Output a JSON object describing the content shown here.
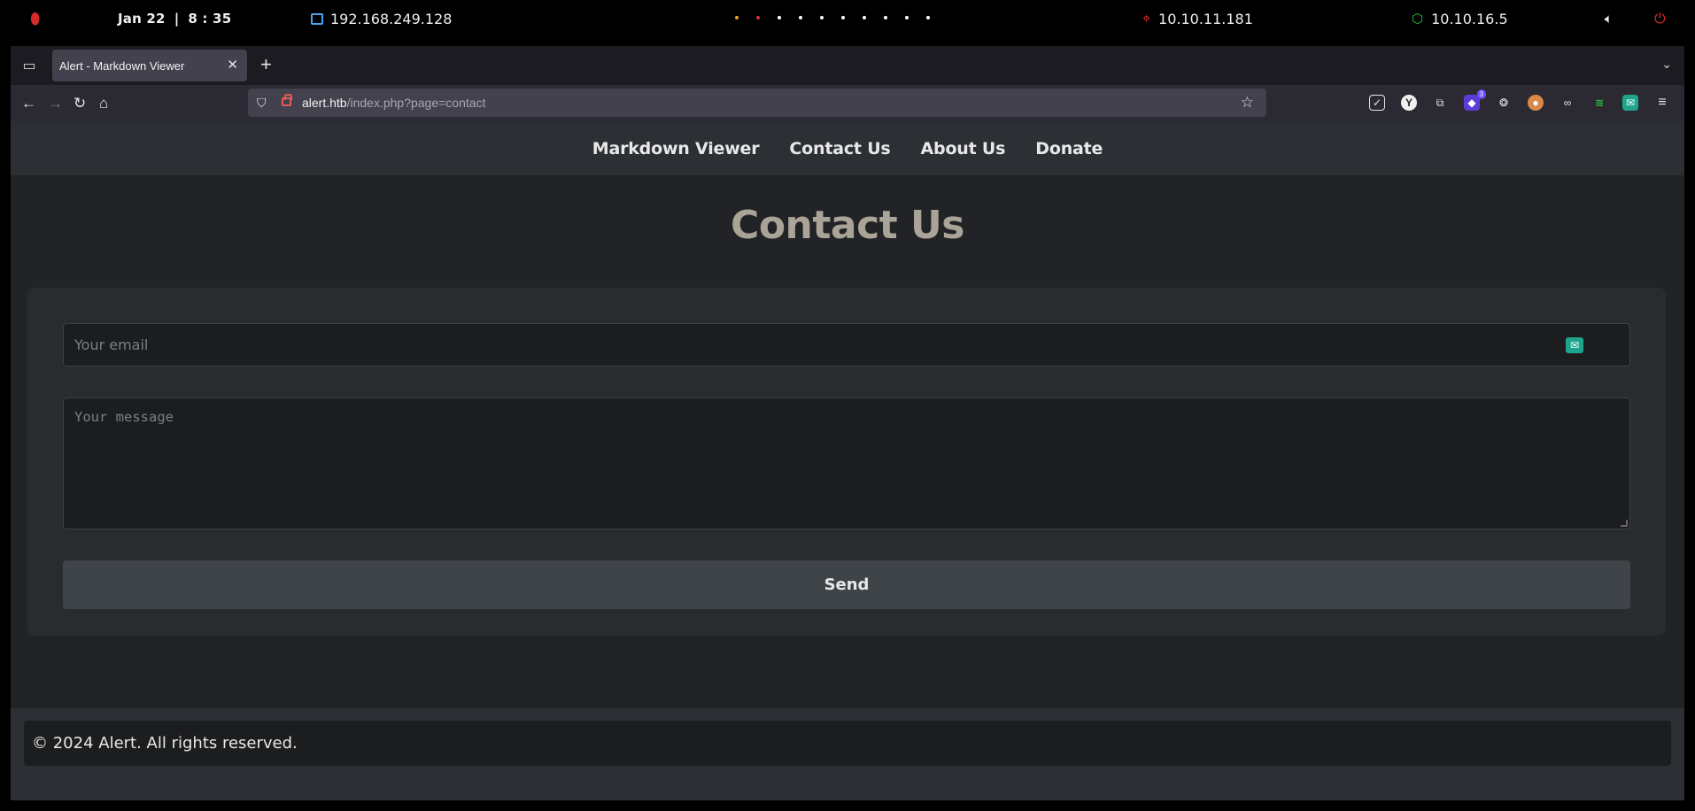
{
  "system_bar": {
    "date": "Jan 22",
    "time": "8 : 35",
    "local_ip": "192.168.249.128",
    "workspace_dots": [
      "•",
      "•",
      "•",
      "•",
      "•",
      "•",
      "•",
      "•",
      "•",
      "•"
    ],
    "target_ip": "10.10.11.181",
    "vpn_ip": "10.10.16.5",
    "colors": {
      "fingerprint": "#d42a2a",
      "target_icon": "#e23232",
      "vpn_icon": "#2bbd3c",
      "power": "#e02a2a"
    }
  },
  "browser": {
    "tab_title": "Alert - Markdown Viewer",
    "url_host": "alert.htb",
    "url_path": "/index.php?page=contact",
    "extension_badge": "3"
  },
  "site": {
    "nav": [
      "Markdown Viewer",
      "Contact Us",
      "About Us",
      "Donate"
    ],
    "heading": "Contact Us",
    "form": {
      "email_placeholder": "Your email",
      "message_placeholder": "Your message",
      "send_label": "Send"
    },
    "footer": "© 2024 Alert. All rights reserved."
  },
  "colors": {
    "heading": "#aaa397",
    "page_bg": "#212326",
    "nav_bg": "#2c3034"
  }
}
